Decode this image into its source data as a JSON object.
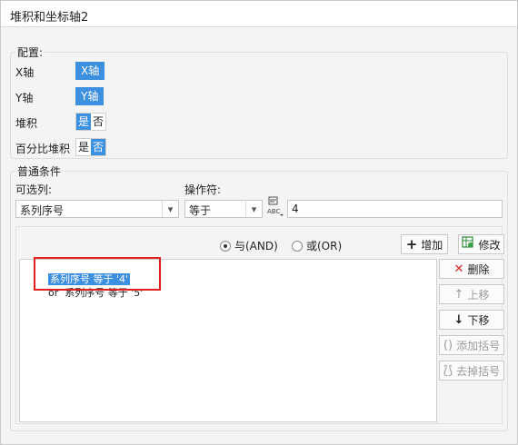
{
  "window": {
    "title": "堆积和坐标轴2"
  },
  "config": {
    "title": "配置:",
    "x_axis": {
      "label": "X轴",
      "value": "X轴"
    },
    "y_axis": {
      "label": "Y轴",
      "value": "Y轴"
    },
    "stack": {
      "label": "堆积",
      "yes": "是",
      "no": "否",
      "selected": "是"
    },
    "percent_stack": {
      "label": "百分比堆积",
      "yes": "是",
      "no": "否",
      "selected": "否"
    }
  },
  "conditions": {
    "title": "普通条件",
    "column_label": "可选列:",
    "column_value": "系列序号",
    "operator_label": "操作符:",
    "operator_value": "等于",
    "value_input": "4",
    "and_label": "与(AND)",
    "or_label": "或(OR)",
    "logic_selected": "and",
    "add_label": "增加",
    "modify_label": "修改",
    "list": [
      "系列序号 等于 '4'",
      "or  系列序号 等于 '5'"
    ],
    "delete_label": "删除",
    "move_up_label": "上移",
    "move_down_label": "下移",
    "add_bracket_label": "添加括号",
    "remove_bracket_label": "去掉括号"
  },
  "colors": {
    "accent": "#3d8fe0",
    "highlight_box": "#e02020"
  }
}
